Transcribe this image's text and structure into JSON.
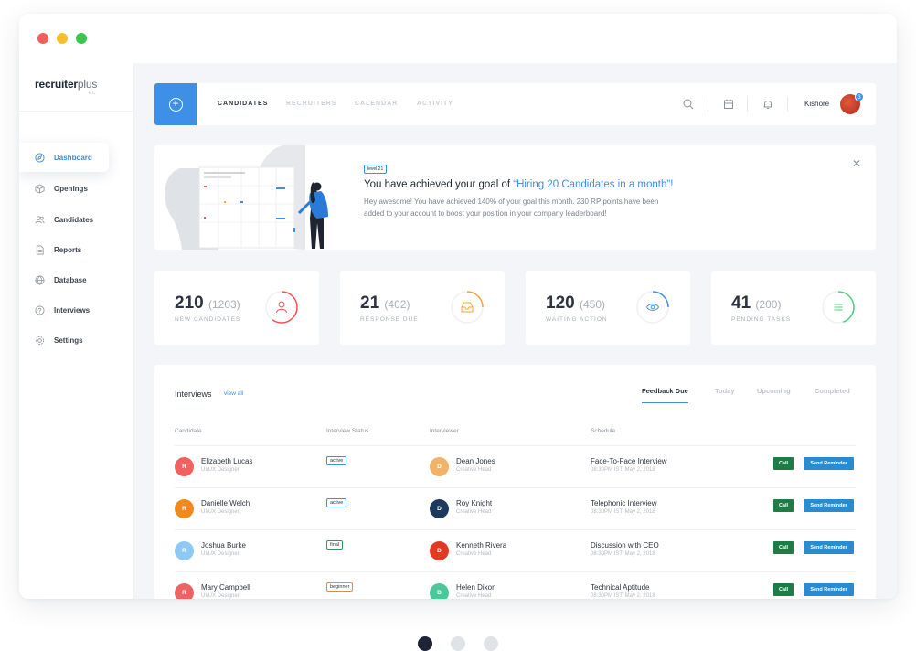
{
  "brand": {
    "name": "recruiter",
    "name_suffix": "plus",
    "sub": "EC"
  },
  "sidebar": {
    "items": [
      {
        "label": "Dashboard",
        "icon": "compass-icon",
        "active": true
      },
      {
        "label": "Openings",
        "icon": "cube-icon"
      },
      {
        "label": "Candidates",
        "icon": "users-icon"
      },
      {
        "label": "Reports",
        "icon": "document-icon"
      },
      {
        "label": "Database",
        "icon": "globe-icon"
      },
      {
        "label": "Interviews",
        "icon": "help-circle-icon"
      },
      {
        "label": "Settings",
        "icon": "gear-icon"
      }
    ]
  },
  "topbar": {
    "tabs": [
      {
        "label": "CANDIDATES",
        "active": true
      },
      {
        "label": "RECRUITERS"
      },
      {
        "label": "CALENDAR"
      },
      {
        "label": "ACTIVITY"
      }
    ],
    "user": {
      "name": "Kishore",
      "badge": "3"
    }
  },
  "banner": {
    "level": "level 21",
    "title_prefix": "You have achieved your goal of ",
    "title_highlight": "“Hiring 20 Candidates in a month”!",
    "body": "Hey awesome! You have achieved 140% of your goal this month. 230 RP points have been added to your account to boost your position in your company leaderboard!"
  },
  "stats": [
    {
      "value": "210",
      "sub": "(1203)",
      "label": "NEW CANDIDATES",
      "color": "#ef5350",
      "progress": 0.6
    },
    {
      "value": "21",
      "sub": "(402)",
      "label": "RESPONSE DUE",
      "color": "#f5a623",
      "progress": 0.25
    },
    {
      "value": "120",
      "sub": "(450)",
      "label": "WAITING ACTION",
      "color": "#3d8fe8",
      "progress": 0.25
    },
    {
      "value": "41",
      "sub": "(200)",
      "label": "PENDING TASKS",
      "color": "#4cd07d",
      "progress": 0.45
    }
  ],
  "interviews": {
    "title": "Interviews",
    "view_all": "view all",
    "filters": [
      "Feedback Due",
      "Today",
      "Upcoming",
      "Completed"
    ],
    "columns": [
      "Candidate",
      "Interview Status",
      "Interviewer",
      "Schedule"
    ],
    "call_label": "Call",
    "reminder_label": "Send Reminder",
    "rows": [
      {
        "cand_initial": "R",
        "cand_color": "#f06262",
        "cand_name": "Elizabeth Lucas",
        "cand_role": "UI/UX Designer",
        "status": "active",
        "int_initial": "D",
        "int_color": "#f0b36a",
        "int_name": "Dean Jones",
        "int_role": "Creative Head",
        "sched": "Face-To-Face Interview",
        "time": "08:30PM IST, May 2, 2018"
      },
      {
        "cand_initial": "R",
        "cand_color": "#f08a1a",
        "cand_name": "Danielle Welch",
        "cand_role": "UI/UX Designer",
        "status": "active",
        "int_initial": "D",
        "int_color": "#1d3a5c",
        "int_name": "Roy Knight",
        "int_role": "Creative Head",
        "sched": "Telephonic Interview",
        "time": "08:30PM IST, May 2, 2018"
      },
      {
        "cand_initial": "R",
        "cand_color": "#8ec8f5",
        "cand_name": "Joshua Burke",
        "cand_role": "UI/UX Designer",
        "status": "final",
        "int_initial": "D",
        "int_color": "#e03a25",
        "int_name": "Kenneth Rivera",
        "int_role": "Creative Head",
        "sched": "Discussion with CEO",
        "time": "08:30PM IST, May 2, 2018"
      },
      {
        "cand_initial": "R",
        "cand_color": "#f06262",
        "cand_name": "Mary Campbell",
        "cand_role": "UI/UX Designer",
        "status": "beginner",
        "int_initial": "D",
        "int_color": "#4cc79a",
        "int_name": "Helen Dixon",
        "int_role": "Creative Head",
        "sched": "Technical Aptitude",
        "time": "08:30PM IST, May 2, 2018"
      }
    ]
  }
}
